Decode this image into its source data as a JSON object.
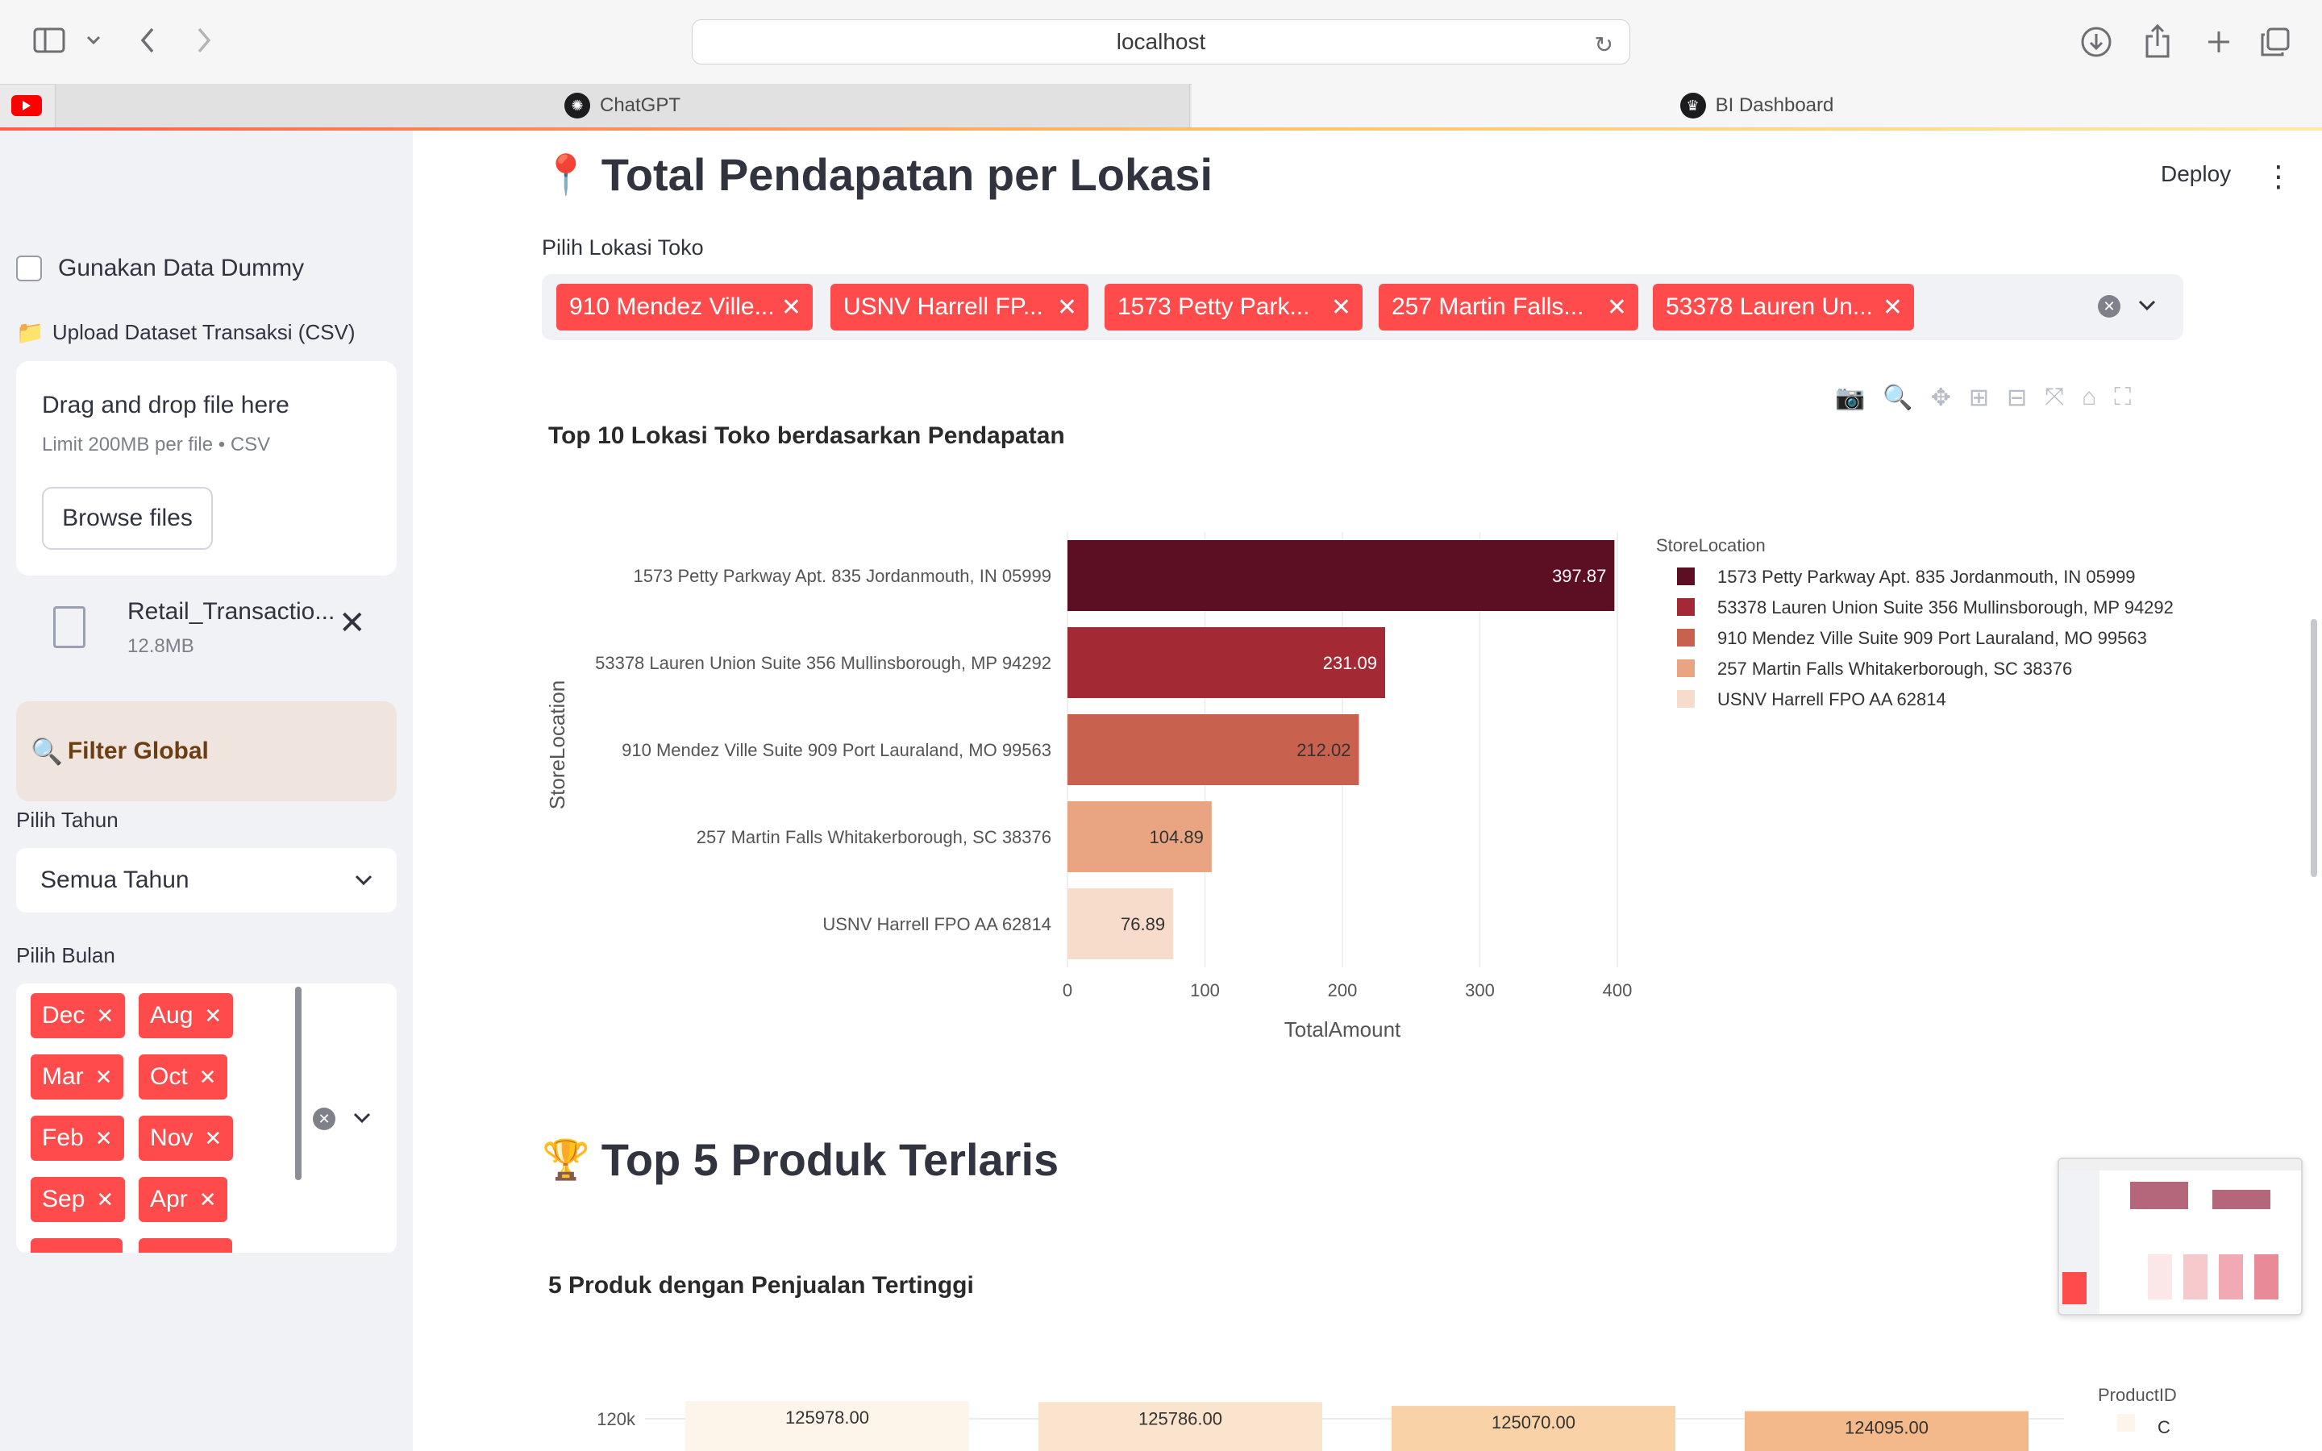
{
  "browser": {
    "url": "localhost",
    "tabs": [
      {
        "label": "ChatGPT"
      },
      {
        "label": "BI Dashboard"
      }
    ]
  },
  "sidebar": {
    "dummy_checkbox_label": "Gunakan Data Dummy",
    "dummy_checked": false,
    "upload_label": "Upload Dataset Transaksi (CSV)",
    "dropzone_title": "Drag and drop file here",
    "dropzone_limit": "Limit 200MB per file • CSV",
    "browse_label": "Browse files",
    "file_name": "Retail_Transactio...",
    "file_size": "12.8MB",
    "filter_title": "Filter Global",
    "year_label": "Pilih Tahun",
    "year_value": "Semua Tahun",
    "month_label": "Pilih Bulan",
    "months": [
      "Dec",
      "Aug",
      "Mar",
      "Oct",
      "Feb",
      "Nov",
      "Sep",
      "Apr"
    ]
  },
  "main": {
    "section1_title": "Total Pendapatan per Lokasi",
    "deploy_label": "Deploy",
    "location_label": "Pilih Lokasi Toko",
    "location_chips": [
      "910 Mendez Ville...",
      "USNV Harrell FP...",
      "1573 Petty Park...",
      "257 Martin Falls...",
      "53378 Lauren Un..."
    ],
    "chart1_title": "Top 10 Lokasi Toko berdasarkan Pendapatan",
    "section2_title": "Top 5 Produk Terlaris",
    "chart2_title": "5 Produk dengan Penjualan Tertinggi"
  },
  "chart_data": [
    {
      "type": "bar",
      "orientation": "horizontal",
      "title": "Top 10 Lokasi Toko berdasarkan Pendapatan",
      "xlabel": "TotalAmount",
      "ylabel": "StoreLocation",
      "xlim": [
        0,
        400
      ],
      "xticks": [
        0,
        100,
        200,
        300,
        400
      ],
      "legend_title": "StoreLocation",
      "legend_position": "right",
      "categories": [
        "1573 Petty Parkway Apt. 835 Jordanmouth, IN 05999",
        "53378 Lauren Union Suite 356 Mullinsborough, MP 94292",
        "910 Mendez Ville Suite 909 Port Lauraland, MO 99563",
        "257 Martin Falls Whitakerborough, SC 38376",
        "USNV Harrell FPO AA 62814"
      ],
      "values": [
        397.87,
        231.09,
        212.02,
        104.89,
        76.89
      ],
      "labels": [
        "397.87",
        "231.09",
        "212.02",
        "104.89",
        "76.89"
      ],
      "colors": [
        "#5c0e22",
        "#a32a35",
        "#c9614f",
        "#e9a582",
        "#f7dccb"
      ]
    },
    {
      "type": "bar",
      "title": "5 Produk dengan Penjualan Tertinggi",
      "legend_title": "ProductID",
      "legend_entries": [
        "C"
      ],
      "yticks": [
        "120k"
      ],
      "values": [
        125978.0,
        125786.0,
        125070.0,
        124095.0
      ],
      "labels": [
        "125978.00",
        "125786.00",
        "125070.00",
        "124095.00"
      ],
      "colors": [
        "#fdf4ea",
        "#fbe4cd",
        "#f9d2a8",
        "#f3b98a"
      ]
    }
  ]
}
